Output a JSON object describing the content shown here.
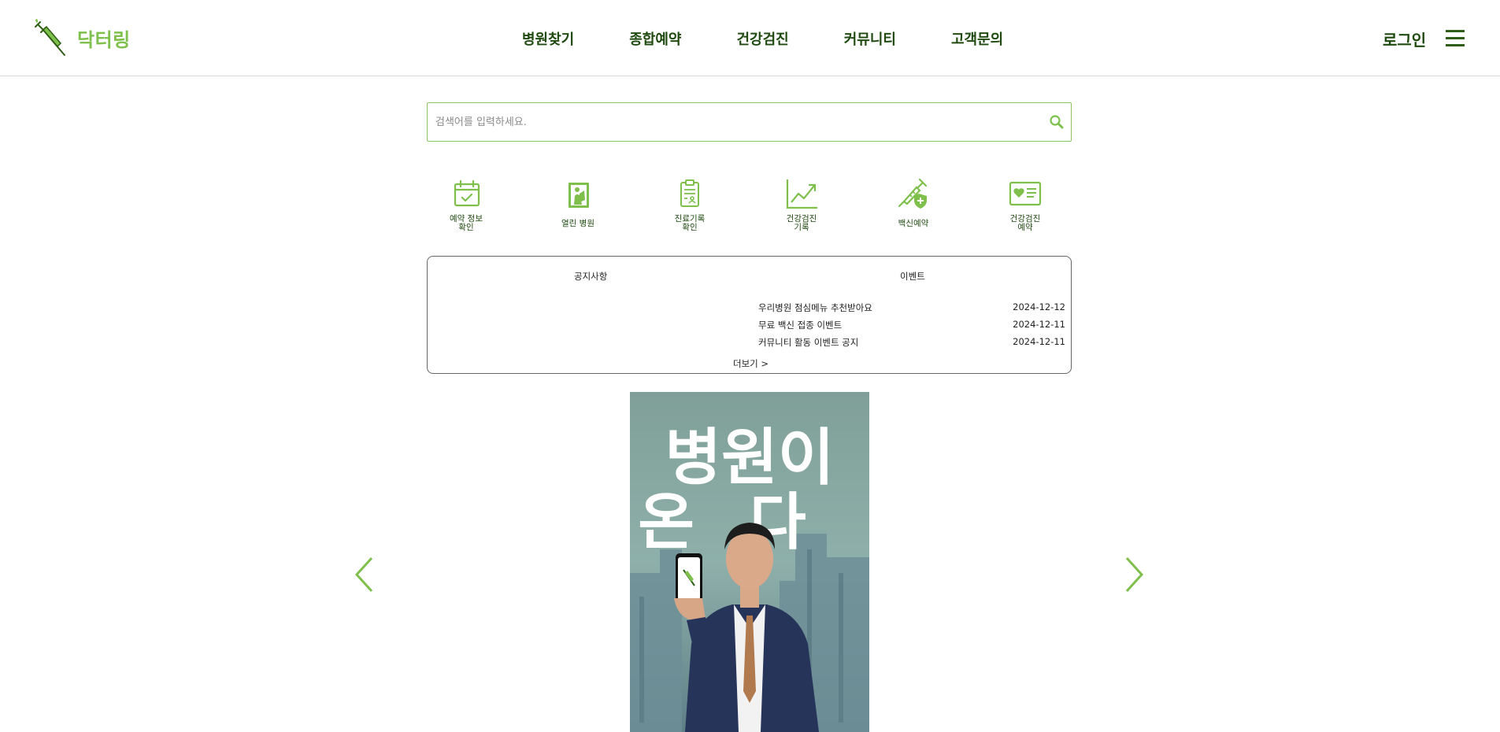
{
  "header": {
    "logo_text": "닥터링",
    "logo_icon": "syringe-icon",
    "nav": [
      {
        "label": "병원찾기"
      },
      {
        "label": "종합예약"
      },
      {
        "label": "건강검진"
      },
      {
        "label": "커뮤니티"
      },
      {
        "label": "고객문의"
      }
    ],
    "login_label": "로그인",
    "menu_icon": "hamburger-menu-icon"
  },
  "search": {
    "placeholder": "검색어를 입력하세요.",
    "value": "",
    "icon": "search-icon"
  },
  "quick_menu": [
    {
      "line1": "예약 정보",
      "line2": "확인",
      "icon": "calendar-check-icon"
    },
    {
      "line1": "열린 병원",
      "line2": "",
      "icon": "open-door-person-icon"
    },
    {
      "line1": "진료기록",
      "line2": "확인",
      "icon": "clipboard-record-icon"
    },
    {
      "line1": "건강검진",
      "line2": "기록",
      "icon": "trend-chart-icon"
    },
    {
      "line1": "백신예약",
      "line2": "",
      "icon": "vaccine-shield-icon"
    },
    {
      "line1": "건강검진",
      "line2": "예약",
      "icon": "health-card-icon"
    }
  ],
  "board": {
    "tabs": [
      {
        "label": "공지사항"
      },
      {
        "label": "이벤트"
      }
    ],
    "items": [
      {
        "title": "우리병원 점심메뉴 추천받아요",
        "date": "2024-12-12"
      },
      {
        "title": "무료 백신 접종 이벤트",
        "date": "2024-12-11"
      },
      {
        "title": "커뮤니티 활동 이벤트 공지",
        "date": "2024-12-11"
      }
    ],
    "more_label": "더보기 >"
  },
  "banner": {
    "headline_line1": "병원이",
    "headline_line2": "온다",
    "prev_icon": "chevron-left-icon",
    "next_icon": "chevron-right-icon"
  },
  "colors": {
    "accent": "#7ec04b",
    "nav_text": "#1f4a10",
    "border": "#8cc560"
  }
}
